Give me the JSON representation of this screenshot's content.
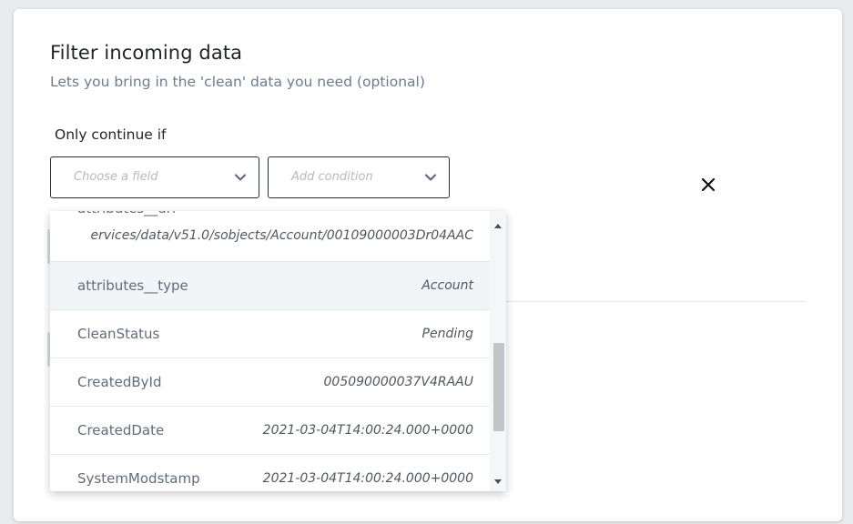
{
  "header": {
    "title": "Filter incoming data",
    "subtitle": "Lets you bring in the 'clean' data you need (optional)"
  },
  "condition": {
    "label": "Only continue if",
    "field_placeholder": "Choose a field",
    "condition_placeholder": "Add condition"
  },
  "dropdown": {
    "items": [
      {
        "key": "attributes__url",
        "value": "ervices/data/v51.0/sobjects/Account/00109000003Dr04AAC"
      },
      {
        "key": "attributes__type",
        "value": "Account"
      },
      {
        "key": "CleanStatus",
        "value": "Pending"
      },
      {
        "key": "CreatedById",
        "value": "005090000037V4RAAU"
      },
      {
        "key": "CreatedDate",
        "value": "2021-03-04T14:00:24.000+0000"
      },
      {
        "key": "SystemModstamp",
        "value": "2021-03-04T14:00:24.000+0000"
      }
    ],
    "highlighted_index": 1
  },
  "colors": {
    "border": "#2a2f36",
    "subtitle": "#6b7c90",
    "row_highlight": "#f2f5f8",
    "placeholder": "#b3bac3"
  }
}
